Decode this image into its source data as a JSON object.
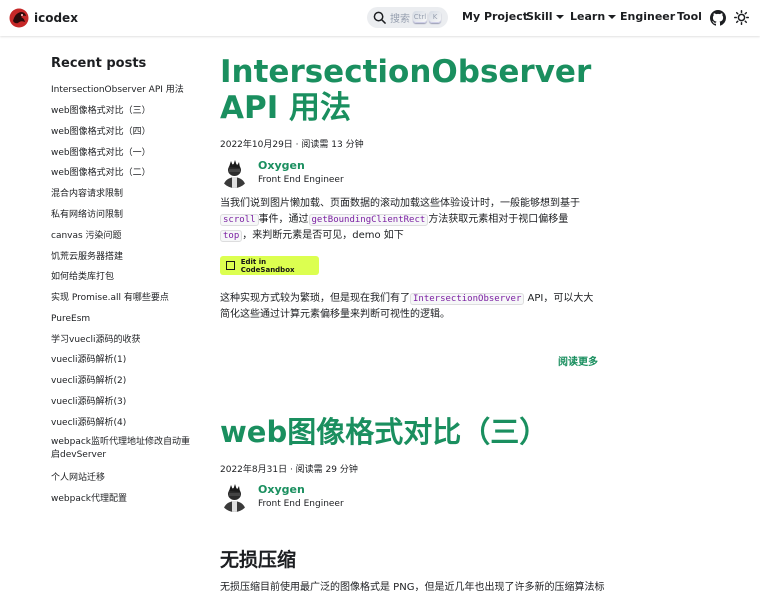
{
  "navbar": {
    "brand_title": "icodex",
    "search_placeholder": "搜索",
    "kbd_ctrl": "Ctrl",
    "kbd_k": "K",
    "items": [
      {
        "label": "My Project"
      },
      {
        "label": "Skill"
      },
      {
        "label": "Learn"
      },
      {
        "label": "Engineer"
      },
      {
        "label": "Tool"
      }
    ],
    "icons": [
      "logo-icon",
      "search-icon",
      "github-icon",
      "theme-toggle-icon"
    ]
  },
  "sidebar": {
    "title": "Recent posts",
    "items": [
      "IntersectionObserver API 用法",
      "web图像格式对比（三）",
      "web图像格式对比（四）",
      "web图像格式对比（一）",
      "web图像格式对比（二）",
      "混合内容请求限制",
      "私有网络访问限制",
      "canvas 污染问题",
      "饥荒云服务器搭建",
      "如何给类库打包",
      "实现 Promise.all 有哪些要点",
      "PureEsm",
      "学习vuecli源码的收获",
      "vuecli源码解析(1)",
      "vuecli源码解析(2)",
      "vuecli源码解析(3)",
      "vuecli源码解析(4)",
      "webpack监听代理地址修改自动重启devServer",
      "个人网站迁移",
      "webpack代理配置"
    ]
  },
  "posts": [
    {
      "title_line1": "IntersectionObserver",
      "title_line2": "API 用法",
      "meta": "2022年10月29日 · 阅读需 13 分钟",
      "author_name": "Oxygen",
      "author_role": "Front End Engineer",
      "p1_a": "当我们说到图片懒加载、页面数据的滚动加载这些体验设计时，一般能够想到基于",
      "p1_code1": "scroll",
      "p1_b": "事件，通过",
      "p1_code2": "getBoundingClientRect",
      "p1_c": "方法获取元素相对于视口偏移量",
      "p1_code3": "top",
      "p1_d": "，来判断元素是否可见，demo 如下",
      "codesandbox_label": "Edit in CodeSandbox",
      "p2_a": "这种实现方式较为繁琐，但是现在我们有了",
      "p2_code": "IntersectionObserver",
      "p2_b": " API，可以大大简化这些通过计算元素偏移量来判断可视性的逻辑。",
      "read_more": "阅读更多"
    },
    {
      "title": "web图像格式对比（三）",
      "meta": "2022年8月31日 · 阅读需 29 分钟",
      "author_name": "Oxygen",
      "author_role": "Front End Engineer",
      "h2": "无损压缩",
      "p1": "无损压缩目前使用最广泛的图像格式是 PNG，但是近几年也出现了许多新的压缩算法标"
    }
  ],
  "colors": {
    "primary": "#1a8f5f",
    "text": "#1c1e21",
    "code_text": "#7b1fa2",
    "codesandbox_bg": "#dcff50"
  }
}
